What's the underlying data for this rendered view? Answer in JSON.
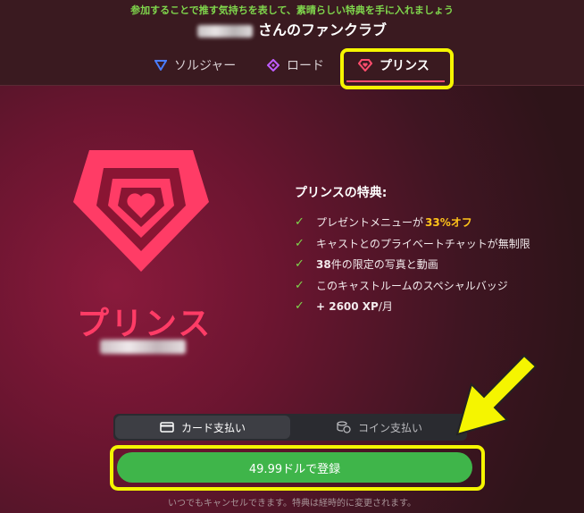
{
  "header": {
    "tagline": "参加することで推す気持ちを表して、素晴らしい特典を手に入れましょう",
    "club_title": "さんのファンクラブ"
  },
  "tabs": [
    {
      "label": "ソルジャー",
      "icon": "triangle-icon",
      "color": "#4a7dff"
    },
    {
      "label": "ロード",
      "icon": "diamond-icon",
      "color": "#c05cff"
    },
    {
      "label": "プリンス",
      "icon": "heart-gem-icon",
      "color": "#ff4d6d",
      "active": true
    }
  ],
  "plan": {
    "name": "プリンス",
    "accent": "#ff3c66"
  },
  "benefits": {
    "title": "プリンスの特典:",
    "items": [
      {
        "pre": "プレゼントメニューが",
        "highlight": "33%オフ",
        "post": ""
      },
      {
        "pre": "キャストとのプライベートチャットが無制限",
        "highlight": "",
        "post": ""
      },
      {
        "pre": "38",
        "highlight": "",
        "post": " 件の限定の写真と動画"
      },
      {
        "pre": "このキャストルームのスペシャルバッジ",
        "highlight": "",
        "post": ""
      },
      {
        "pre": "+ 2600 XP",
        "highlight": "",
        "post": " /月"
      }
    ]
  },
  "payment": {
    "card_label": "カード支払い",
    "coin_label": "コイン支払い",
    "selected": "card"
  },
  "register_button": "49.99ドルで登録",
  "footnote": "いつでもキャンセルできます。特典は経時的に変更されます。",
  "colors": {
    "check": "#7fd64c",
    "highlight": "#ffc21a",
    "button": "#3fb54a",
    "annotation": "#f5f500"
  }
}
